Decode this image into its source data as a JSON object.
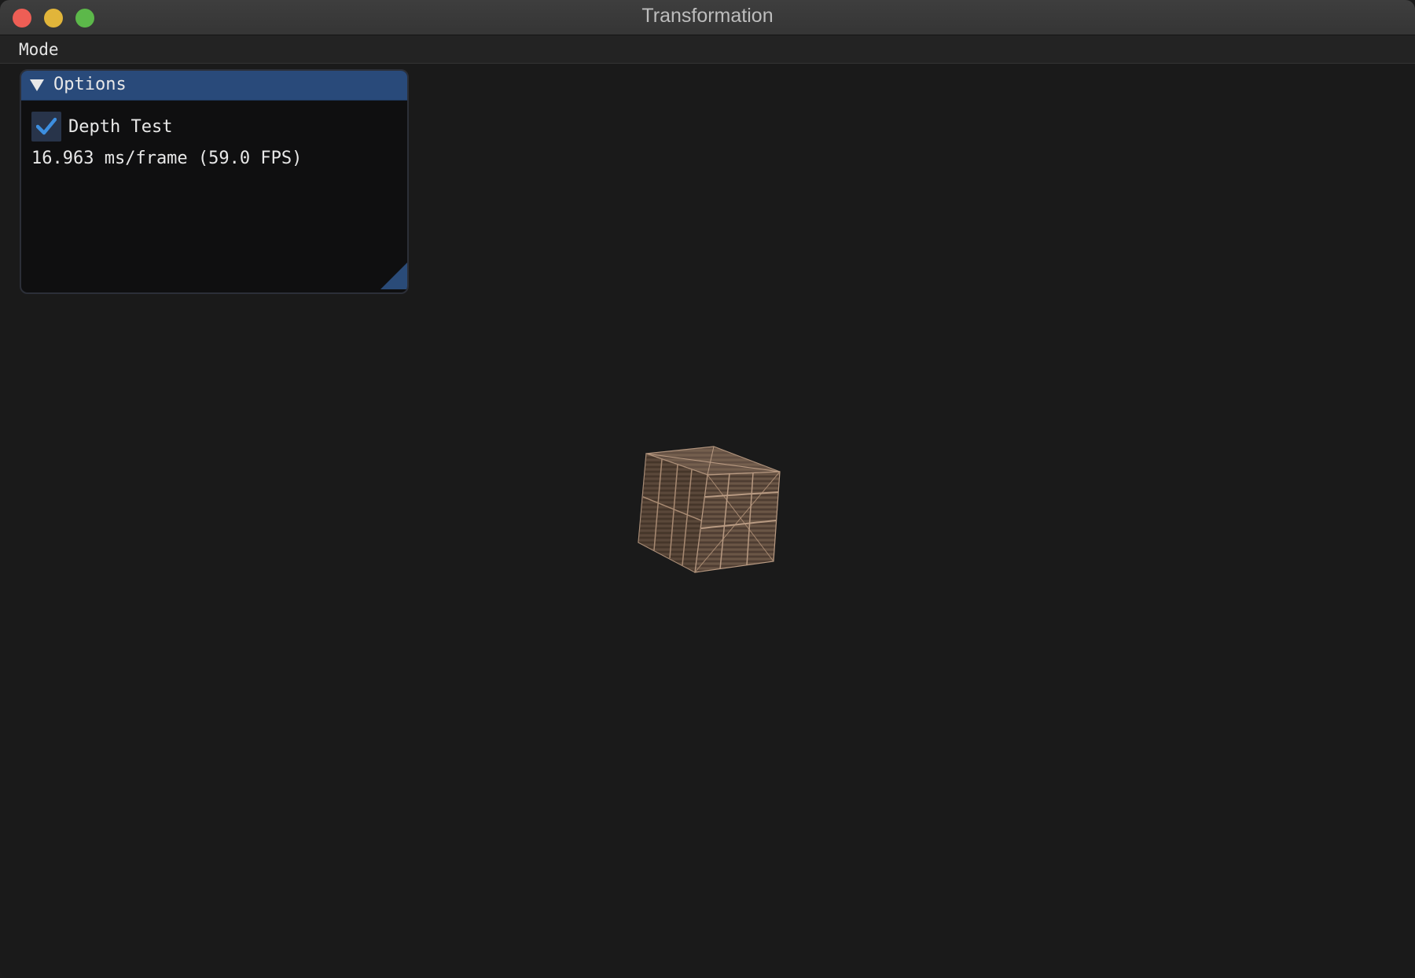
{
  "window": {
    "title": "Transformation"
  },
  "menubar": {
    "items": [
      {
        "label": "Mode"
      }
    ]
  },
  "options_panel": {
    "title": "Options",
    "expanded": true,
    "depth_test": {
      "label": "Depth Test",
      "checked": true
    },
    "frame_stats": "16.963 ms/frame (59.0 FPS)"
  },
  "colors": {
    "background": "#1a1a1a",
    "panel_header": "#294a7a",
    "checkbox_accent": "#3d8fe0",
    "crate_wood": "#6b5646"
  },
  "icons": {
    "collapse": "triangle-down-icon",
    "check": "checkmark-icon",
    "resize": "resize-grip-icon"
  }
}
